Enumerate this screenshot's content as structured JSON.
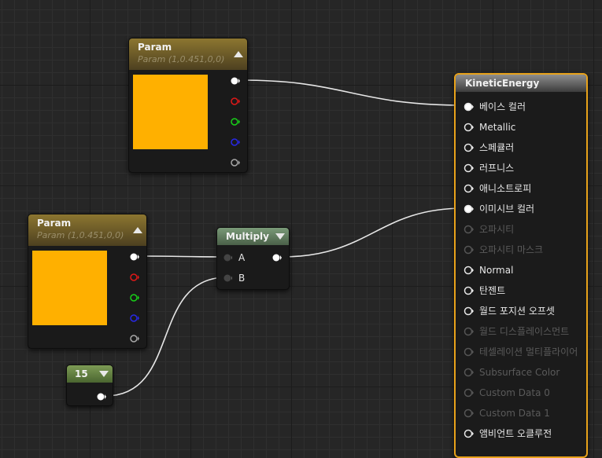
{
  "param_node_1": {
    "title": "Param",
    "subtitle": "Param (1,0.451,0,0)",
    "color": "#FFB000"
  },
  "param_node_2": {
    "title": "Param",
    "subtitle": "Param (1,0.451,0,0)",
    "color": "#FFB000"
  },
  "multiply_node": {
    "title": "Multiply",
    "input_a": "A",
    "input_b": "B"
  },
  "constant_node": {
    "value": "15"
  },
  "material_node": {
    "title": "KineticEnergy",
    "inputs": [
      {
        "label": "베이스 컬러",
        "connected": true,
        "enabled": true
      },
      {
        "label": "Metallic",
        "connected": false,
        "enabled": true
      },
      {
        "label": "스페큘러",
        "connected": false,
        "enabled": true
      },
      {
        "label": "러프니스",
        "connected": false,
        "enabled": true
      },
      {
        "label": "애니소트로피",
        "connected": false,
        "enabled": true
      },
      {
        "label": "이미시브 컬러",
        "connected": true,
        "enabled": true
      },
      {
        "label": "오파시티",
        "connected": false,
        "enabled": false
      },
      {
        "label": "오파시티 마스크",
        "connected": false,
        "enabled": false
      },
      {
        "label": "Normal",
        "connected": false,
        "enabled": true
      },
      {
        "label": "탄젠트",
        "connected": false,
        "enabled": true
      },
      {
        "label": "월드 포지션 오프셋",
        "connected": false,
        "enabled": true
      },
      {
        "label": "월드 디스플레이스먼트",
        "connected": false,
        "enabled": false
      },
      {
        "label": "테셀레이션 멀티플라이어",
        "connected": false,
        "enabled": false
      },
      {
        "label": "Subsurface Color",
        "connected": false,
        "enabled": false
      },
      {
        "label": "Custom Data 0",
        "connected": false,
        "enabled": false
      },
      {
        "label": "Custom Data 1",
        "connected": false,
        "enabled": false
      },
      {
        "label": "앰비언트 오클루전",
        "connected": false,
        "enabled": true
      }
    ]
  },
  "pin_colors": {
    "rgba": "#FFFFFF",
    "r": "#E01818",
    "g": "#18D018",
    "b": "#2828E8",
    "a": "#A8A8A8"
  },
  "colors": {
    "selection": "#E8A21A",
    "wire": "#E6E6E6"
  }
}
